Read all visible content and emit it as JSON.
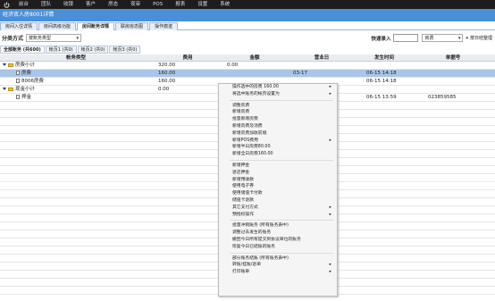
{
  "menubar": {
    "items": [
      "前台",
      "团队",
      "收银",
      "客户",
      "房态",
      "夜审",
      "POS",
      "报表",
      "设置",
      "系统"
    ]
  },
  "titlebar": {
    "title": "经济双人房8001详情"
  },
  "tabs": [
    {
      "label": "房间入住详情",
      "active": false
    },
    {
      "label": "房间高级功能",
      "active": false
    },
    {
      "label": "房间账务详情",
      "active": true
    },
    {
      "label": "联房房态图",
      "active": false
    },
    {
      "label": "操作痕迹",
      "active": false
    }
  ],
  "toolbar": {
    "category_label": "分类方式",
    "category_value": "按账务类型",
    "quick_entry_label": "快速录入",
    "quick_entry_value": "",
    "room_select": "房费",
    "date_label": "按日结整理"
  },
  "filters": [
    {
      "label": "全部账务 (共600)",
      "active": true
    },
    {
      "label": "帐页1 (共0)",
      "active": false
    },
    {
      "label": "帐页2 (共0)",
      "active": false
    },
    {
      "label": "帐页3 (共0)",
      "active": false
    }
  ],
  "grid": {
    "headers": [
      "帐务类型",
      "费用",
      "金额",
      "营业日",
      "发生时间",
      "单据号"
    ],
    "rows": [
      {
        "kind": "group",
        "label": "房费小计",
        "fee": "320.00",
        "amount": "0.00",
        "bizday": "",
        "time": "",
        "receipt": ""
      },
      {
        "kind": "item",
        "label": "房费",
        "fee": "160.00",
        "amount": "",
        "bizday": "03-17",
        "time": "06-15 14:18",
        "receipt": "",
        "selected": true
      },
      {
        "kind": "item",
        "label": "8006房费",
        "fee": "160.00",
        "amount": "",
        "bizday": "",
        "time": "06-15 14:18",
        "receipt": ""
      },
      {
        "kind": "group",
        "label": "现金小计",
        "fee": "0.00",
        "amount": "",
        "bizday": "",
        "time": "",
        "receipt": ""
      },
      {
        "kind": "item",
        "label": "押金",
        "fee": "",
        "amount": "",
        "bizday": "",
        "time": "06-15 13:59",
        "receipt": "023859585"
      }
    ]
  },
  "context_menu": {
    "items": [
      {
        "label": "操作选中的房费 160.00",
        "submenu": true
      },
      {
        "label": "将选中账务的帐页设置为",
        "submenu": true
      },
      {
        "sep": true
      },
      {
        "label": "调整房费"
      },
      {
        "label": "新增房费"
      },
      {
        "label": "批量新增房费"
      },
      {
        "label": "新增房费及消费"
      },
      {
        "label": "新增房费加收前缀"
      },
      {
        "label": "新增POS费用",
        "submenu": true
      },
      {
        "label": "新增半日房费80.00"
      },
      {
        "label": "新增全日房费160.00"
      },
      {
        "sep": true
      },
      {
        "label": "新增押金"
      },
      {
        "label": "退还押金"
      },
      {
        "label": "新增预收款"
      },
      {
        "label": "使用电子券"
      },
      {
        "label": "使用储值卡付款"
      },
      {
        "label": "储值卡退款"
      },
      {
        "label": "其它支付方式",
        "submenu": true
      },
      {
        "label": "预授权操作",
        "submenu": true
      },
      {
        "sep": true
      },
      {
        "label": "批量冲销账务 (所有账务表中)"
      },
      {
        "label": "调整过去发生的账务"
      },
      {
        "label": "撤回今日所有提交到协议单位的账务"
      },
      {
        "label": "恢复今日已结账的账务"
      },
      {
        "sep": true
      },
      {
        "label": "部分账务结账 (所有账务表中)"
      },
      {
        "label": "转账/挂账/退单",
        "submenu": true
      },
      {
        "label": "打印账单",
        "submenu": true
      }
    ]
  }
}
